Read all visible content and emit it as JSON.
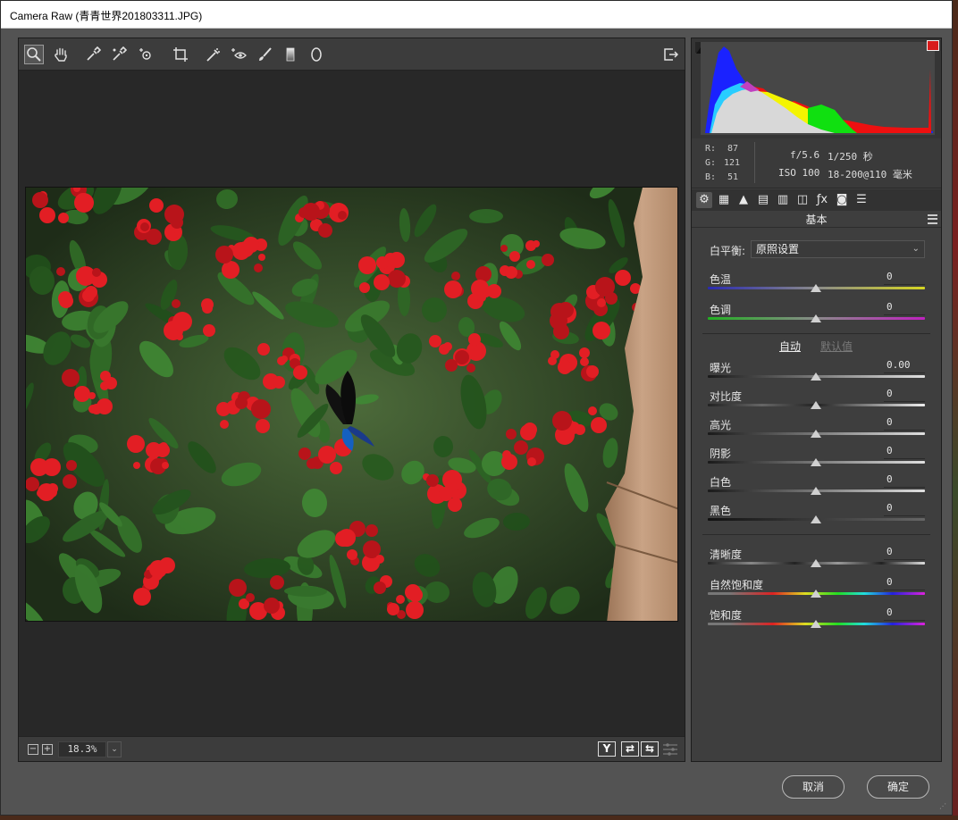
{
  "window": {
    "title": "Camera Raw (青青世界201803311.JPG)"
  },
  "toolbar": {
    "tools": [
      {
        "name": "zoom-tool",
        "icon": "magnifier-icon",
        "glyph": "🔍",
        "active": true
      },
      {
        "name": "hand-tool",
        "icon": "hand-icon",
        "glyph": "✋"
      },
      {
        "name": "white-balance-tool",
        "icon": "eyedropper-icon",
        "glyph": "✎"
      },
      {
        "name": "color-sampler-tool",
        "icon": "color-sampler-icon",
        "glyph": "✐"
      },
      {
        "name": "targeted-adjustment-tool",
        "icon": "target-adjust-icon",
        "glyph": "⊕"
      },
      {
        "name": "crop-tool",
        "icon": "crop-icon",
        "glyph": "⌗"
      },
      {
        "name": "spot-removal-tool",
        "icon": "spot-removal-icon",
        "glyph": "✎"
      },
      {
        "name": "red-eye-tool",
        "icon": "red-eye-icon",
        "glyph": "⊙"
      },
      {
        "name": "adjustment-brush-tool",
        "icon": "brush-icon",
        "glyph": "✒"
      },
      {
        "name": "graduated-filter-tool",
        "icon": "graduated-filter-icon",
        "glyph": "▮"
      },
      {
        "name": "radial-filter-tool",
        "icon": "radial-filter-icon",
        "glyph": "⬯"
      }
    ],
    "export_icon": "open-export-icon"
  },
  "statusbar": {
    "zoom_minus": "−",
    "zoom_plus": "+",
    "zoom_value": "18.3%",
    "zoom_dropdown": "⌄",
    "view_buttons": [
      "Y",
      "⇄",
      "⇆"
    ]
  },
  "histogram": {
    "colors": {
      "blue": "#1a22ff",
      "cyan": "#2ae0ff",
      "magenta": "#c040c0",
      "yellow": "#f4f400",
      "green": "#10e010",
      "red": "#ee1010",
      "luma": "#d8d8d8"
    }
  },
  "info": {
    "r_label": "R:",
    "r_value": "87",
    "g_label": "G:",
    "g_value": "121",
    "b_label": "B:",
    "b_value": "51",
    "aperture": "f/5.6",
    "shutter": "1/250 秒",
    "iso": "ISO 100",
    "lens": "18-200@110 毫米"
  },
  "tabs": [
    {
      "name": "tab-basic",
      "icon": "aperture-icon",
      "glyph": "⚙",
      "active": true
    },
    {
      "name": "tab-tone-curve",
      "icon": "tone-curve-icon",
      "glyph": "▦"
    },
    {
      "name": "tab-detail",
      "icon": "detail-icon",
      "glyph": "▲"
    },
    {
      "name": "tab-hsl",
      "icon": "hsl-icon",
      "glyph": "▤"
    },
    {
      "name": "tab-split-toning",
      "icon": "split-toning-icon",
      "glyph": "▥"
    },
    {
      "name": "tab-lens",
      "icon": "lens-icon",
      "glyph": "◫"
    },
    {
      "name": "tab-effects",
      "icon": "fx-icon",
      "glyph": "ƒx"
    },
    {
      "name": "tab-camera-calibration",
      "icon": "camera-icon",
      "glyph": "◙"
    },
    {
      "name": "tab-presets",
      "icon": "presets-icon",
      "glyph": "☰"
    }
  ],
  "basic": {
    "section_title": "基本",
    "wb_label": "白平衡:",
    "wb_value": "原照设置",
    "temp_label": "色温",
    "temp_value": "0",
    "tint_label": "色调",
    "tint_value": "0",
    "auto_label": "自动",
    "default_label": "默认值",
    "exposure_label": "曝光",
    "exposure_value": "0.00",
    "contrast_label": "对比度",
    "contrast_value": "0",
    "highlights_label": "高光",
    "highlights_value": "0",
    "shadows_label": "阴影",
    "shadows_value": "0",
    "whites_label": "白色",
    "whites_value": "0",
    "blacks_label": "黑色",
    "blacks_value": "0",
    "clarity_label": "清晰度",
    "clarity_value": "0",
    "vibrance_label": "自然饱和度",
    "vibrance_value": "0",
    "saturation_label": "饱和度",
    "saturation_value": "0"
  },
  "buttons": {
    "cancel": "取消",
    "ok": "确定"
  }
}
